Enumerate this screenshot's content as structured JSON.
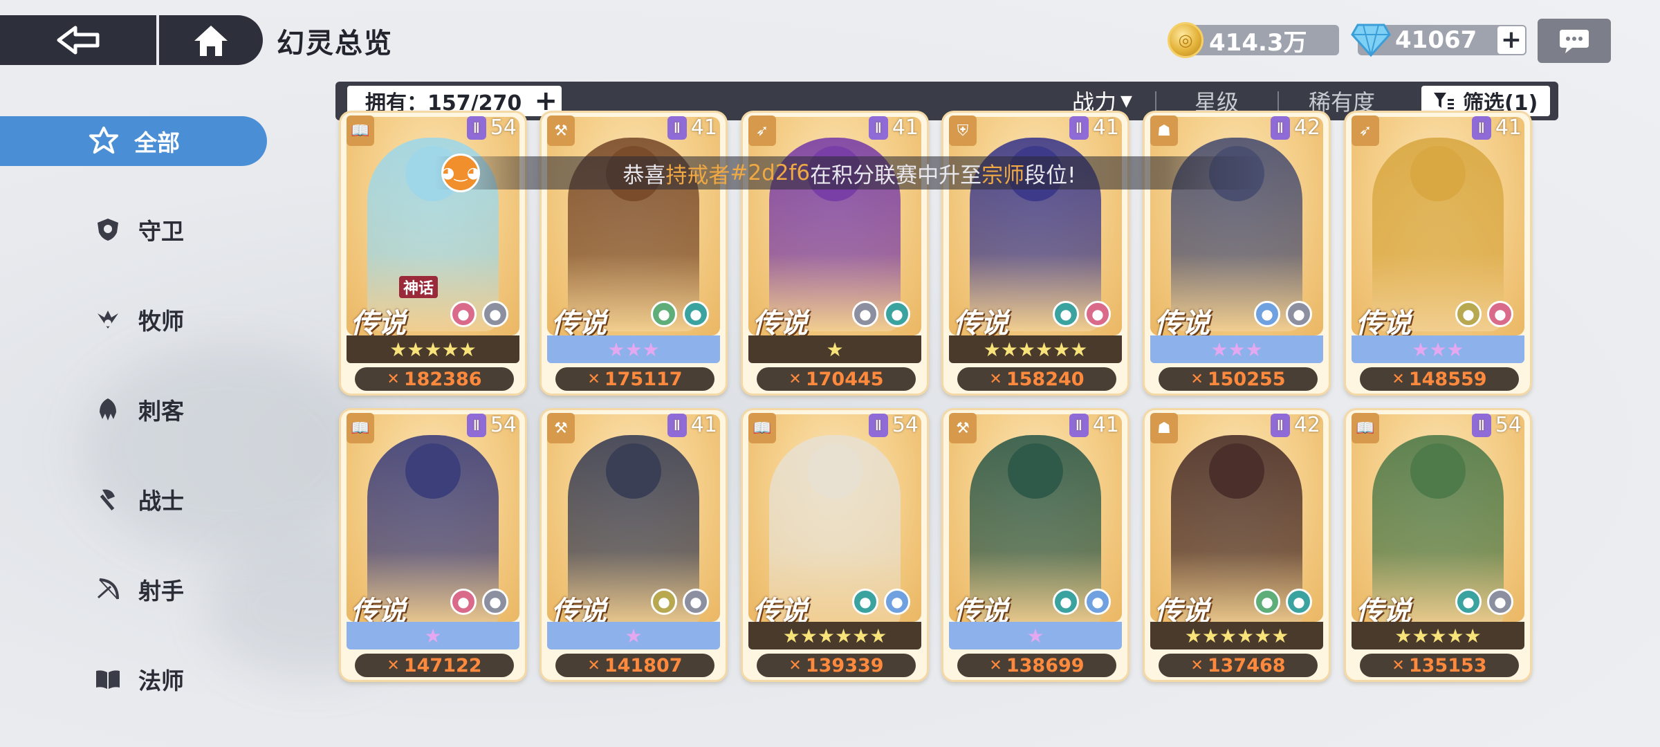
{
  "page_title": "幻灵总览",
  "currency": {
    "gold": "414.3万",
    "gems": "41067"
  },
  "filterbar": {
    "owned_label": "拥有：157/270",
    "sort_power": "战力",
    "sort_star": "星级",
    "sort_rarity": "稀有度",
    "filter_label": "筛选(1)"
  },
  "sidebar": {
    "items": [
      {
        "label": "全部",
        "icon": "star-hexagram-icon"
      },
      {
        "label": "守卫",
        "icon": "shield-icon"
      },
      {
        "label": "牧师",
        "icon": "priest-icon"
      },
      {
        "label": "刺客",
        "icon": "assassin-icon"
      },
      {
        "label": "战士",
        "icon": "axe-icon"
      },
      {
        "label": "射手",
        "icon": "bow-icon"
      },
      {
        "label": "法师",
        "icon": "book-icon"
      }
    ]
  },
  "banner": {
    "prefix": "恭喜",
    "player_class": "持戒者",
    "player_id": "#2d2f6",
    "middle": "在积分联赛中升至",
    "rank": "宗师",
    "suffix": "段位!"
  },
  "cards": [
    {
      "rank": "传说",
      "level": "54",
      "stars": "★★★★★",
      "bar": "dark",
      "power": "182386",
      "myth": "神话",
      "tint": "#9fd7e8",
      "cls_icon": "book-icon",
      "elements": [
        "#d96a8a",
        "#8c8fa0"
      ]
    },
    {
      "rank": "传说",
      "level": "41",
      "stars": "★★★",
      "bar": "blue",
      "power": "175117",
      "myth": "",
      "tint": "#7a4c2c",
      "cls_icon": "axe-icon",
      "elements": [
        "#5fae7a",
        "#3aa3a0"
      ]
    },
    {
      "rank": "传说",
      "level": "41",
      "stars": "★",
      "bar": "dark",
      "power": "170445",
      "myth": "",
      "tint": "#7a3fa6",
      "cls_icon": "bow-icon",
      "elements": [
        "#8c8fa0",
        "#3aa3a0"
      ]
    },
    {
      "rank": "传说",
      "level": "41",
      "stars": "★★★★★★",
      "bar": "dark",
      "power": "158240",
      "myth": "",
      "tint": "#3d3a8a",
      "cls_icon": "shield-icon",
      "elements": [
        "#3aa3a0",
        "#d96a8a"
      ]
    },
    {
      "rank": "传说",
      "level": "42",
      "stars": "★★★",
      "bar": "blue",
      "power": "150255",
      "myth": "",
      "tint": "#4a4f70",
      "cls_icon": "assassin-icon",
      "elements": [
        "#6fa0e0",
        "#8c8fa0"
      ]
    },
    {
      "rank": "传说",
      "level": "41",
      "stars": "★★★",
      "bar": "blue",
      "power": "148559",
      "myth": "",
      "tint": "#d9a842",
      "cls_icon": "bow-icon",
      "elements": [
        "#b8a850",
        "#d96a8a"
      ]
    },
    {
      "rank": "传说",
      "level": "54",
      "stars": "★",
      "bar": "blue",
      "power": "147122",
      "myth": "",
      "tint": "#3d3f7a",
      "cls_icon": "book-icon",
      "elements": [
        "#d96a8a",
        "#8c8fa0"
      ]
    },
    {
      "rank": "传说",
      "level": "41",
      "stars": "★",
      "bar": "blue",
      "power": "141807",
      "myth": "",
      "tint": "#3a3f55",
      "cls_icon": "axe-icon",
      "elements": [
        "#b8a850",
        "#8c8fa0"
      ]
    },
    {
      "rank": "传说",
      "level": "54",
      "stars": "★★★★★★",
      "bar": "dark",
      "power": "139339",
      "myth": "",
      "tint": "#e8e0d0",
      "cls_icon": "book-icon",
      "elements": [
        "#3aa3a0",
        "#6fa0e0"
      ]
    },
    {
      "rank": "传说",
      "level": "41",
      "stars": "★",
      "bar": "blue",
      "power": "138699",
      "myth": "",
      "tint": "#2f5a4a",
      "cls_icon": "axe-icon",
      "elements": [
        "#3aa3a0",
        "#6fa0e0"
      ]
    },
    {
      "rank": "传说",
      "level": "42",
      "stars": "★★★★★★",
      "bar": "dark",
      "power": "137468",
      "myth": "",
      "tint": "#4a2f2a",
      "cls_icon": "assassin-icon",
      "elements": [
        "#5fae7a",
        "#3aa3a0"
      ]
    },
    {
      "rank": "传说",
      "level": "54",
      "stars": "★★★★★",
      "bar": "dark",
      "power": "135153",
      "myth": "",
      "tint": "#4f7a4a",
      "cls_icon": "book-icon",
      "elements": [
        "#3aa3a0",
        "#8c8fa0"
      ]
    }
  ]
}
